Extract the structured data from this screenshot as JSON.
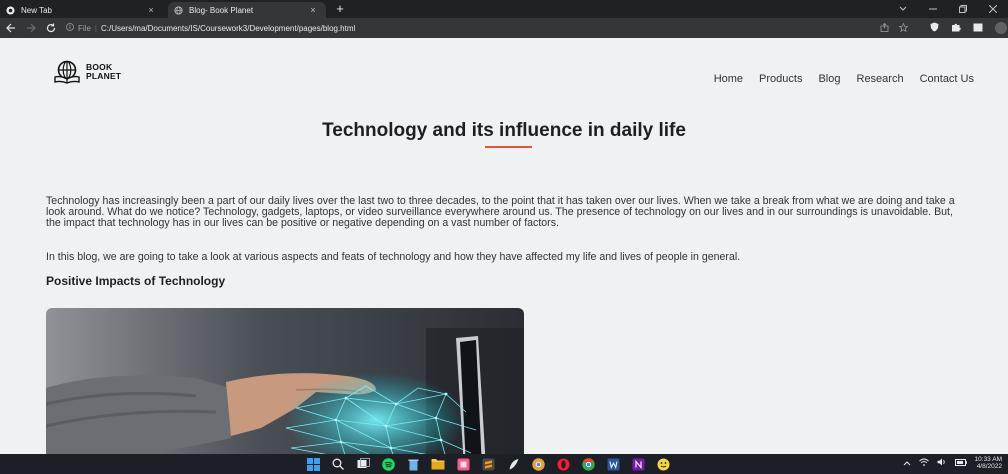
{
  "browser": {
    "tabs": [
      {
        "title": "New Tab",
        "icon": "chrome-icon"
      },
      {
        "title": "Blog- Book Planet",
        "icon": "globe-icon",
        "active": true
      }
    ],
    "new_tab_label": "+",
    "close_label": "×",
    "url": {
      "scheme_label": "File",
      "separator": "|",
      "path": "C:/Users/ma/Documents/IS/Coursework3/Development/pages/blog.html"
    }
  },
  "site": {
    "logo_lines": [
      "BOOK",
      "PLANET"
    ],
    "nav": [
      "Home",
      "Products",
      "Blog",
      "Research",
      "Contact Us"
    ]
  },
  "article": {
    "title": "Technology and its influence in daily life",
    "paragraphs": [
      "Technology has increasingly been a part of our daily lives over the last two to three decades, to the point that it has taken over our lives. When we take a break from what we are doing and take a look around. What do we notice? Technology, gadgets, laptops, or video surveillance everywhere around us. The presence of technology on our lives and in our surroundings is unavoidable. But, the impact that technology has in our lives can be positive or negative depending on a vast number of factors.",
      "In this blog, we are going to take a look at various aspects and feats of technology and how they have affected my life and lives of people in general."
    ],
    "section_heading": "Positive Impacts of Technology"
  },
  "taskbar": {
    "time": "10:33 AM",
    "date": "4/8/2022"
  },
  "colors": {
    "accent_underline": "#e2553d",
    "page_bg": "#eff1f2",
    "chrome_dark": "#202124",
    "chrome_toolbar": "#35363a"
  }
}
